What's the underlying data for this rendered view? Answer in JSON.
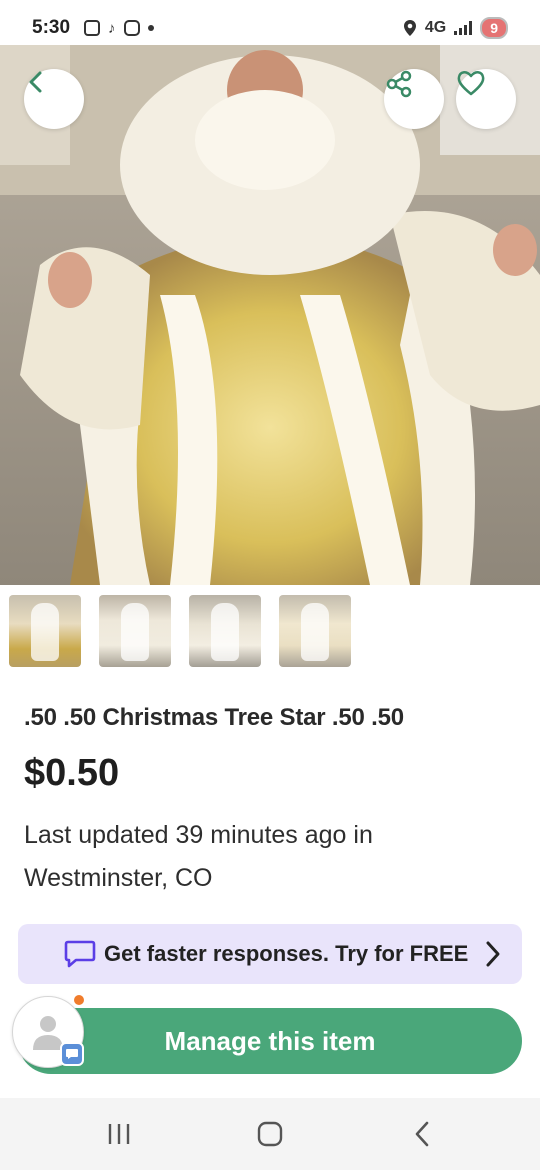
{
  "status_bar": {
    "time": "5:30",
    "network": "4G",
    "battery": "9"
  },
  "hero": {
    "icons": [
      "back-arrow-icon",
      "share-icon",
      "heart-icon"
    ]
  },
  "thumbnails": [
    {
      "selected": true
    },
    {
      "selected": false
    },
    {
      "selected": false
    },
    {
      "selected": false
    }
  ],
  "listing": {
    "title": ".50 .50 Christmas Tree Star .50 .50",
    "price": "$0.50",
    "updated_line1": "Last updated 39 minutes ago in",
    "updated_line2": "Westminster, CO"
  },
  "promo": {
    "text": "Get faster responses. Try for FREE",
    "accent": "#5b3ee6"
  },
  "manage": {
    "label": "Manage this item",
    "color": "#4aa77a"
  }
}
